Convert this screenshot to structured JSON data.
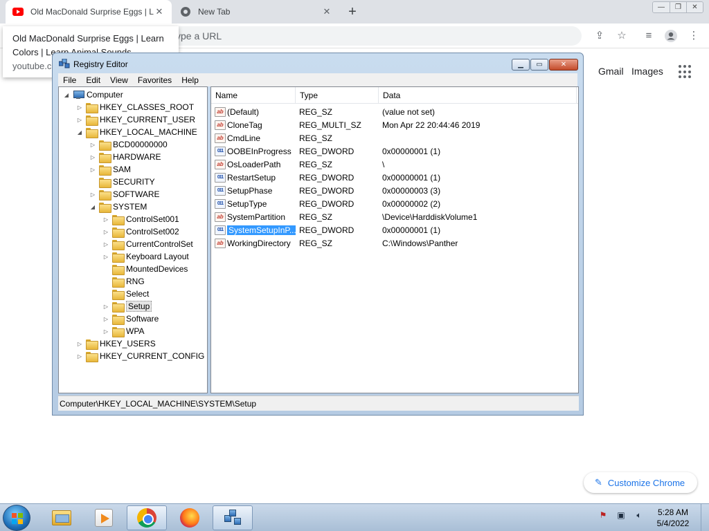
{
  "browser": {
    "tabs": [
      {
        "title": "Old MacDonald Surprise Eggs | Learn Colors | Learn Animal Sounds",
        "active": true
      },
      {
        "title": "New Tab",
        "active": false
      }
    ],
    "omnibox_placeholder": "ype a URL",
    "tooltip": {
      "title": "Old MacDonald Surprise Eggs | Learn Colors | Learn Animal Sounds",
      "url": "youtube.com"
    },
    "ntp": {
      "gmail": "Gmail",
      "images": "Images",
      "customize": "Customize Chrome"
    },
    "window_controls": [
      "—",
      "❐",
      "✕"
    ]
  },
  "regedit": {
    "title": "Registry Editor",
    "menu": [
      "File",
      "Edit",
      "View",
      "Favorites",
      "Help"
    ],
    "tree": [
      {
        "label": "Computer",
        "level": 0,
        "exp": "open",
        "icon": "pc"
      },
      {
        "label": "HKEY_CLASSES_ROOT",
        "level": 1,
        "exp": "closed"
      },
      {
        "label": "HKEY_CURRENT_USER",
        "level": 1,
        "exp": "closed"
      },
      {
        "label": "HKEY_LOCAL_MACHINE",
        "level": 1,
        "exp": "open"
      },
      {
        "label": "BCD00000000",
        "level": 2,
        "exp": "closed"
      },
      {
        "label": "HARDWARE",
        "level": 2,
        "exp": "closed"
      },
      {
        "label": "SAM",
        "level": 2,
        "exp": "closed"
      },
      {
        "label": "SECURITY",
        "level": 2,
        "exp": "none"
      },
      {
        "label": "SOFTWARE",
        "level": 2,
        "exp": "closed"
      },
      {
        "label": "SYSTEM",
        "level": 2,
        "exp": "open"
      },
      {
        "label": "ControlSet001",
        "level": 3,
        "exp": "closed"
      },
      {
        "label": "ControlSet002",
        "level": 3,
        "exp": "closed"
      },
      {
        "label": "CurrentControlSet",
        "level": 3,
        "exp": "closed"
      },
      {
        "label": "Keyboard Layout",
        "level": 3,
        "exp": "closed"
      },
      {
        "label": "MountedDevices",
        "level": 3,
        "exp": "none"
      },
      {
        "label": "RNG",
        "level": 3,
        "exp": "none"
      },
      {
        "label": "Select",
        "level": 3,
        "exp": "none"
      },
      {
        "label": "Setup",
        "level": 3,
        "exp": "closed",
        "selected": true
      },
      {
        "label": "Software",
        "level": 3,
        "exp": "closed"
      },
      {
        "label": "WPA",
        "level": 3,
        "exp": "closed"
      },
      {
        "label": "HKEY_USERS",
        "level": 1,
        "exp": "closed"
      },
      {
        "label": "HKEY_CURRENT_CONFIG",
        "level": 1,
        "exp": "closed"
      }
    ],
    "columns": [
      "Name",
      "Type",
      "Data"
    ],
    "values": [
      {
        "name": "(Default)",
        "type": "REG_SZ",
        "data": "(value not set)",
        "icon": "sz"
      },
      {
        "name": "CloneTag",
        "type": "REG_MULTI_SZ",
        "data": "Mon Apr 22 20:44:46 2019",
        "icon": "sz"
      },
      {
        "name": "CmdLine",
        "type": "REG_SZ",
        "data": "",
        "icon": "sz"
      },
      {
        "name": "OOBEInProgress",
        "type": "REG_DWORD",
        "data": "0x00000001 (1)",
        "icon": "bin"
      },
      {
        "name": "OsLoaderPath",
        "type": "REG_SZ",
        "data": "\\",
        "icon": "sz"
      },
      {
        "name": "RestartSetup",
        "type": "REG_DWORD",
        "data": "0x00000001 (1)",
        "icon": "bin"
      },
      {
        "name": "SetupPhase",
        "type": "REG_DWORD",
        "data": "0x00000003 (3)",
        "icon": "bin"
      },
      {
        "name": "SetupType",
        "type": "REG_DWORD",
        "data": "0x00000002 (2)",
        "icon": "bin"
      },
      {
        "name": "SystemPartition",
        "type": "REG_SZ",
        "data": "\\Device\\HarddiskVolume1",
        "icon": "sz"
      },
      {
        "name": "SystemSetupInP...",
        "type": "REG_DWORD",
        "data": "0x00000001 (1)",
        "icon": "bin",
        "selected": true
      },
      {
        "name": "WorkingDirectory",
        "type": "REG_SZ",
        "data": "C:\\Windows\\Panther",
        "icon": "sz"
      }
    ],
    "status": "Computer\\HKEY_LOCAL_MACHINE\\SYSTEM\\Setup",
    "icon_labels": {
      "sz": "ab",
      "bin": "011"
    }
  },
  "taskbar": {
    "clock_time": "5:28 AM",
    "clock_date": "5/4/2022"
  }
}
